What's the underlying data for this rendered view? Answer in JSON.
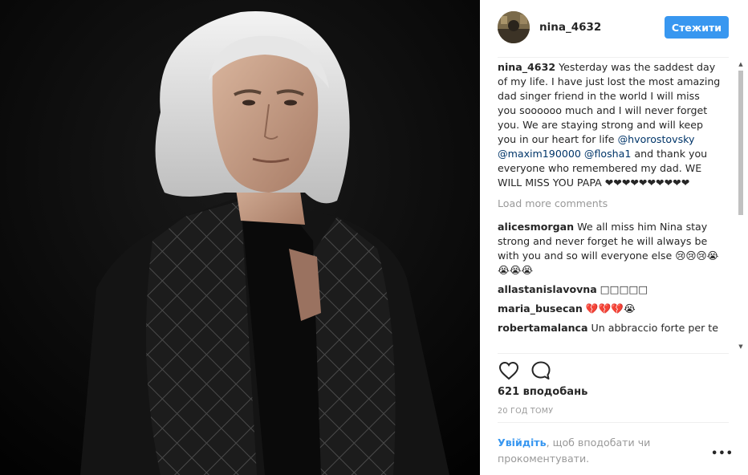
{
  "post": {
    "username": "nina_4632",
    "follow_label": "Стежити",
    "caption_user": "nina_4632",
    "caption_text_1": " Yesterday was the saddest day of my life. I have just lost the most amazing dad singer friend in the world I will miss you soooooo much and I will never forget you. We are staying strong and will keep you in our heart for life ",
    "mention_1": "@hvorostovsky",
    "mention_2": "@maxim190000",
    "mention_3": "@flosha1",
    "caption_text_2": " and thank you everyone who remembered my dad. WE WILL MISS YOU PAPA ❤❤❤❤❤❤❤❤❤❤",
    "load_more": "Load more comments",
    "comments": [
      {
        "user": "alicesmorgan",
        "text": " We all miss him Nina stay strong and never forget he will always be with you and so will everyone else 😢😢😢😭😭😭😭"
      },
      {
        "user": "allastanislavovna",
        "text": " □□□□□"
      },
      {
        "user": "maria_busecan",
        "text": " 💔💔💔😭"
      },
      {
        "user": "robertamalanca",
        "text": " Un abbraccio forte per te"
      }
    ],
    "likes": "621 вподобань",
    "time": "20 ГОД ТОМУ",
    "login_link": "Увійдіть",
    "login_text": ", щоб вподобати чи прокоментувати.",
    "more_label": "•••"
  },
  "icons": {
    "like": "heart-icon",
    "comment": "comment-icon",
    "more": "more-icon"
  },
  "colors": {
    "accent": "#3897f0",
    "mention": "#003569",
    "muted": "#999999"
  }
}
